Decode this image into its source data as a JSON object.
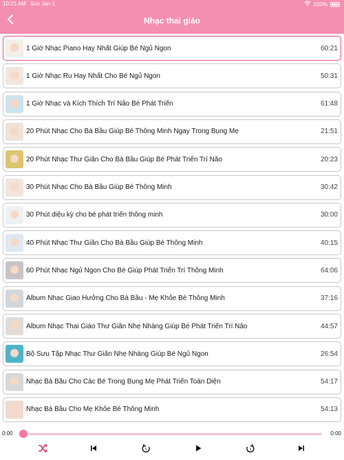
{
  "status_bar": {
    "time": "10:21 AM",
    "date": "Sun Jan 1",
    "battery": "100%"
  },
  "header": {
    "title": "Nhạc thai giáo"
  },
  "colors": {
    "accent": "#f58fb2",
    "active_border": "#e25a82",
    "progress": "#f1789f"
  },
  "tracks": [
    {
      "title": "1 Giờ Nhạc Piano Hay Nhất Giúp Bé Ngủ Ngon",
      "duration": "60:21",
      "active": true,
      "thumb": "#f3efe9"
    },
    {
      "title": "1 Giờ Nhạc Ru Hay Nhất Cho Bé Ngủ Ngon",
      "duration": "50:31",
      "active": false,
      "thumb": "#f1e6df"
    },
    {
      "title": "1 Giờ Nhạc và Kích Thích Trí Não Bé Phát Triển",
      "duration": "61:48",
      "active": false,
      "thumb": "#cfe3ee"
    },
    {
      "title": "20 Phút Nhạc Cho Bà Bầu Giúp Bé Thông Minh Ngay Trong Bụng Mẹ",
      "duration": "21:51",
      "active": false,
      "thumb": "#efe2d6"
    },
    {
      "title": "20 Phút Nhạc Thư Giãn Cho Bà Bầu Giúp Bé Phát Triển Trí Não",
      "duration": "20:23",
      "active": false,
      "thumb": "#d9c66f"
    },
    {
      "title": "30 Phút Nhạc Cho Bà Bầu Giúp Bé Thông Minh",
      "duration": "30:42",
      "active": false,
      "thumb": "#f2e4dc"
    },
    {
      "title": "30 Phút diệu kỳ cho bé phát triển thông minh",
      "duration": "30:00",
      "active": false,
      "thumb": "#eef1f3"
    },
    {
      "title": "40 Phút Nhạc Thư Giãn Cho Bà Bầu Giúp Bé Thông Minh",
      "duration": "40:15",
      "active": false,
      "thumb": "#dfe8ef"
    },
    {
      "title": "60 Phút Nhạc Ngủ Ngon Cho Bé Giúp Phát Triển Trí Thông Minh",
      "duration": "64:06",
      "active": false,
      "thumb": "#c9c3c8"
    },
    {
      "title": "Album Nhạc Giao Hưởng Cho Bà Bầu - Mẹ Khỏe Bé Thông Minh",
      "duration": "37:16",
      "active": false,
      "thumb": "#cfd7dc"
    },
    {
      "title": "Album Nhạc Thai Giáo Thư Giãn Nhẹ Nhàng Giúp Bé Phát Triển Trí Não",
      "duration": "44:57",
      "active": false,
      "thumb": "#e2dcd9"
    },
    {
      "title": "Bộ Sưu Tập Nhạc Thư Giãn Nhẹ Nhàng Giúp Bé Ngủ Ngon",
      "duration": "26:54",
      "active": false,
      "thumb": "#4fb3c9"
    },
    {
      "title": "Nhạc Bà Bầu Cho Các Bé Trong Bụng Mẹ Phát Triển Toàn Diện",
      "duration": "54:17",
      "active": false,
      "thumb": "#d8d8d8"
    },
    {
      "title": "Nhạc Bà Bầu Cho Mẹ Khỏe Bé Thông Minh",
      "duration": "54:13",
      "active": false,
      "thumb": "#f0d9cf"
    }
  ],
  "player": {
    "current_time": "0:00",
    "total_time": "0:00",
    "progress": 0
  },
  "icons": {
    "back": "chevron-left-icon",
    "shuffle": "shuffle-icon",
    "previous": "skip-previous-icon",
    "rewind": "rewind-icon",
    "play": "play-icon",
    "forward": "forward-icon",
    "next": "skip-next-icon"
  }
}
